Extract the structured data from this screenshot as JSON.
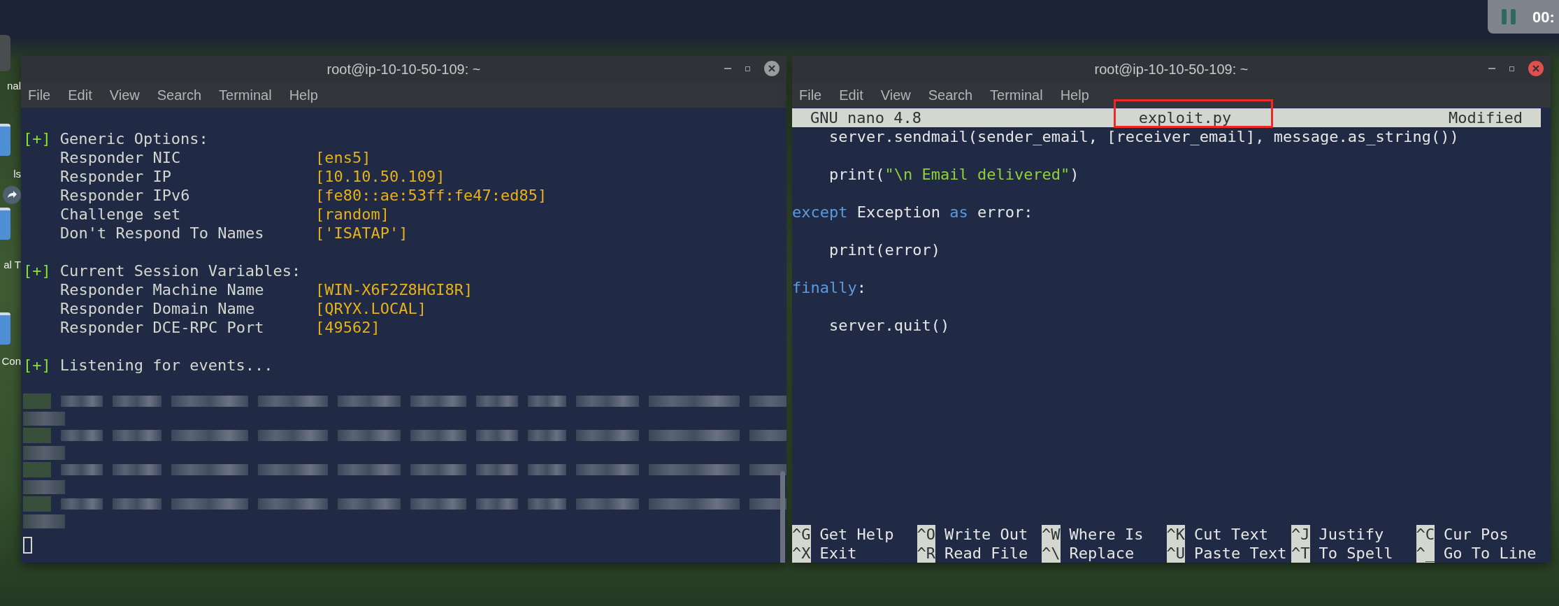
{
  "desktop": {
    "icons": [
      {
        "kind": "tile"
      },
      {
        "kind": "label",
        "label": "nal"
      },
      {
        "kind": "folder"
      },
      {
        "kind": "label",
        "label": "ls"
      },
      {
        "kind": "share"
      },
      {
        "kind": "folder"
      },
      {
        "kind": "label",
        "label": "al T"
      },
      {
        "kind": "folder"
      },
      {
        "kind": "label",
        "label": "Con"
      }
    ]
  },
  "recorder": {
    "paused": true,
    "time": "00:"
  },
  "windows": [
    {
      "kind": "responder",
      "active": false,
      "title": "root@ip-10-10-50-109: ~",
      "menu": [
        "File",
        "Edit",
        "View",
        "Search",
        "Terminal",
        "Help"
      ],
      "sections": [
        {
          "marker": "[+]",
          "heading": "Generic Options:",
          "rows": [
            {
              "name": "Responder NIC",
              "value": "[ens5]"
            },
            {
              "name": "Responder IP",
              "value": "[10.10.50.109]"
            },
            {
              "name": "Responder IPv6",
              "value": "[fe80::ae:53ff:fe47:ed85]"
            },
            {
              "name": "Challenge set",
              "value": "[random]"
            },
            {
              "name": "Don't Respond To Names",
              "value": "['ISATAP']"
            }
          ]
        },
        {
          "marker": "[+]",
          "heading": "Current Session Variables:",
          "rows": [
            {
              "name": "Responder Machine Name",
              "value": "[WIN-X6F2Z8HGI8R]"
            },
            {
              "name": "Responder Domain Name",
              "value": "[QRYX.LOCAL]"
            },
            {
              "name": "Responder DCE-RPC Port",
              "value": "[49562]"
            }
          ]
        },
        {
          "marker": "[+]",
          "heading": "Listening for events..."
        }
      ],
      "redacted": [
        {
          "kind": "long"
        },
        {
          "kind": "short"
        },
        {
          "kind": "long"
        },
        {
          "kind": "short"
        },
        {
          "kind": "long"
        },
        {
          "kind": "short"
        },
        {
          "kind": "long"
        },
        {
          "kind": "short"
        }
      ],
      "cursor_visible": true
    },
    {
      "kind": "nano",
      "active": true,
      "title": "root@ip-10-10-50-109: ~",
      "menu": [
        "File",
        "Edit",
        "View",
        "Search",
        "Terminal",
        "Help"
      ],
      "header": {
        "app": "GNU nano 4.8",
        "file": "exploit.py",
        "file_highlighted": true,
        "status": "Modified"
      },
      "lines": [
        {
          "kind": "code",
          "tokens": [
            {
              "kind": "plain",
              "text": "    server.sendmail(sender_email, [receiver_email], message.as_string())"
            }
          ]
        },
        {
          "kind": "blank"
        },
        {
          "kind": "code",
          "tokens": [
            {
              "kind": "plain",
              "text": "    print("
            },
            {
              "kind": "string",
              "text": "\"\\n Email delivered\""
            },
            {
              "kind": "plain",
              "text": ")"
            }
          ]
        },
        {
          "kind": "blank"
        },
        {
          "kind": "code",
          "tokens": [
            {
              "kind": "keyword",
              "text": "except"
            },
            {
              "kind": "plain",
              "text": " Exception "
            },
            {
              "kind": "keyword",
              "text": "as"
            },
            {
              "kind": "plain",
              "text": " error:"
            }
          ]
        },
        {
          "kind": "blank"
        },
        {
          "kind": "code",
          "tokens": [
            {
              "kind": "plain",
              "text": "    print(error)"
            }
          ]
        },
        {
          "kind": "blank"
        },
        {
          "kind": "code",
          "tokens": [
            {
              "kind": "keyword",
              "text": "finally"
            },
            {
              "kind": "plain",
              "text": ":"
            }
          ]
        },
        {
          "kind": "blank"
        },
        {
          "kind": "code",
          "tokens": [
            {
              "kind": "plain",
              "text": "    server.quit()"
            }
          ]
        }
      ],
      "shortcuts": [
        [
          {
            "key": "^G",
            "label": "Get Help"
          },
          {
            "key": "^O",
            "label": "Write Out"
          },
          {
            "key": "^W",
            "label": "Where Is"
          },
          {
            "key": "^K",
            "label": "Cut Text"
          },
          {
            "key": "^J",
            "label": "Justify"
          },
          {
            "key": "^C",
            "label": "Cur Pos"
          }
        ],
        [
          {
            "key": "^X",
            "label": "Exit"
          },
          {
            "key": "^R",
            "label": "Read File"
          },
          {
            "key": "^\\",
            "label": "Replace"
          },
          {
            "key": "^U",
            "label": "Paste Text"
          },
          {
            "key": "^T",
            "label": "To Spell"
          },
          {
            "key": "^_",
            "label": "Go To Line"
          }
        ]
      ]
    }
  ]
}
